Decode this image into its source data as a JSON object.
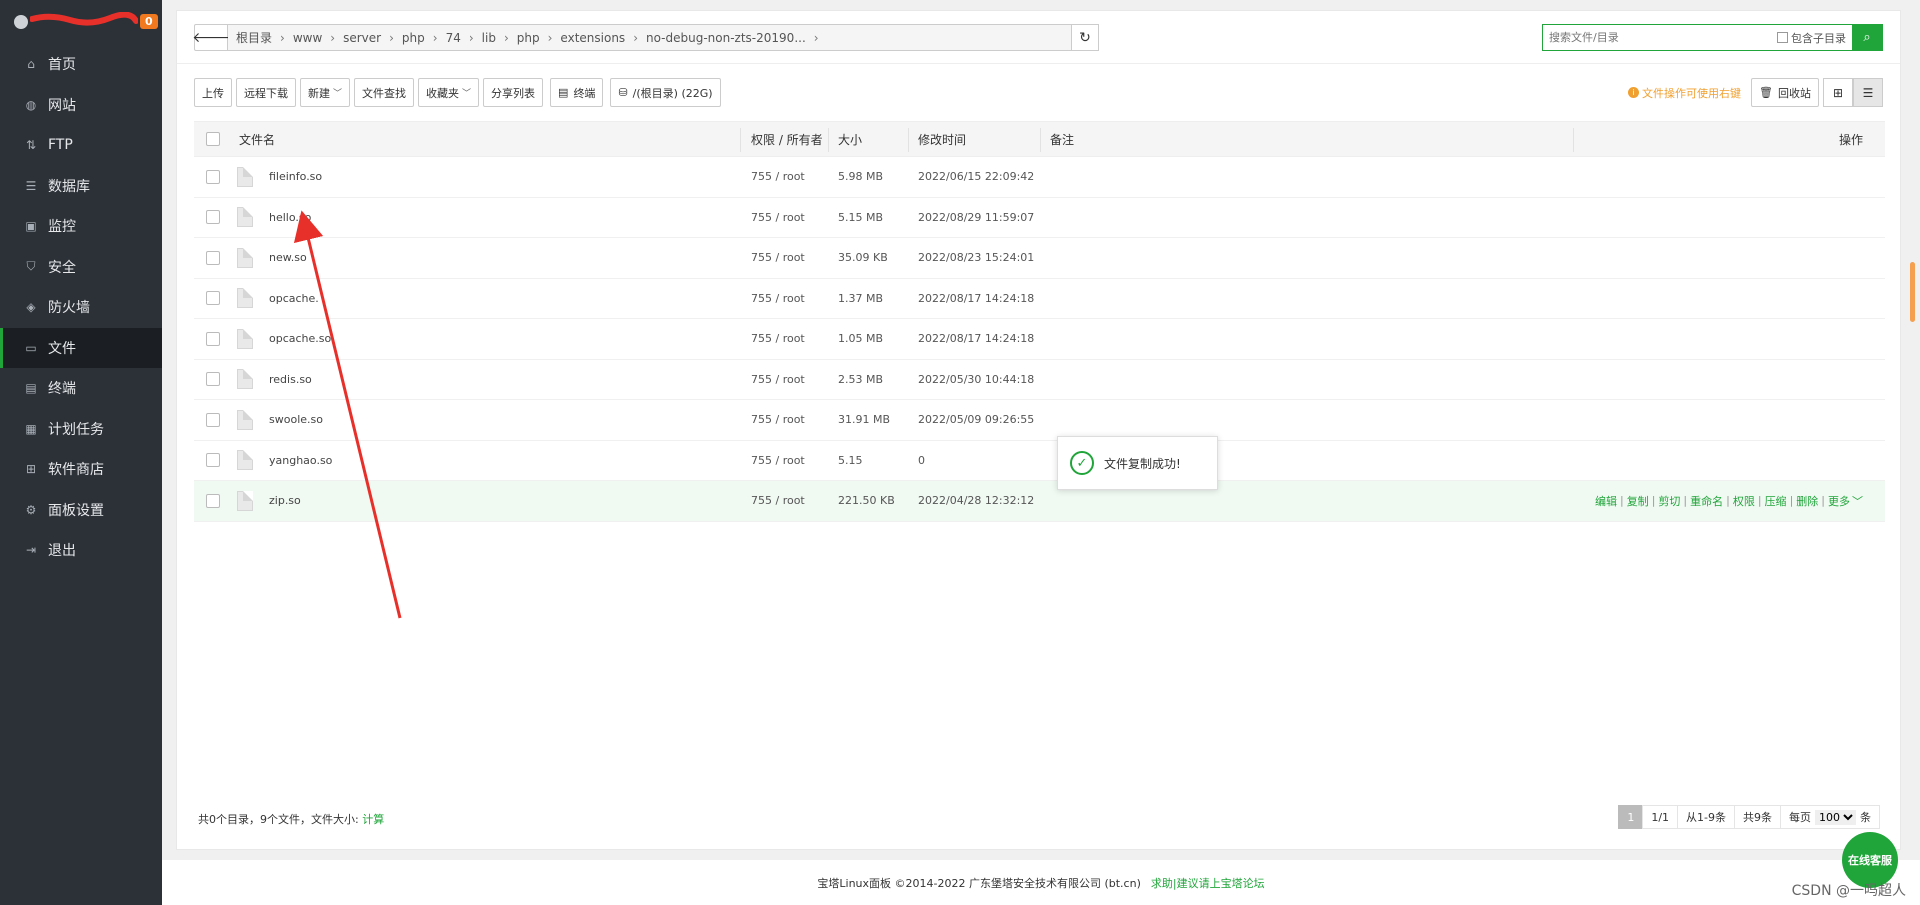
{
  "sidebar": {
    "badge": "0",
    "items": [
      {
        "label": "首页",
        "icon": "home-icon",
        "glyph": "⌂"
      },
      {
        "label": "网站",
        "icon": "globe-icon",
        "glyph": "◍"
      },
      {
        "label": "FTP",
        "icon": "ftp-icon",
        "glyph": "⇅"
      },
      {
        "label": "数据库",
        "icon": "database-icon",
        "glyph": "☰"
      },
      {
        "label": "监控",
        "icon": "monitor-icon",
        "glyph": "▣"
      },
      {
        "label": "安全",
        "icon": "shield-icon",
        "glyph": "⛉"
      },
      {
        "label": "防火墙",
        "icon": "firewall-icon",
        "glyph": "◈"
      },
      {
        "label": "文件",
        "icon": "folder-icon",
        "glyph": "▭",
        "active": true
      },
      {
        "label": "终端",
        "icon": "terminal-icon",
        "glyph": "▤"
      },
      {
        "label": "计划任务",
        "icon": "calendar-icon",
        "glyph": "▦"
      },
      {
        "label": "软件商店",
        "icon": "apps-icon",
        "glyph": "⊞"
      },
      {
        "label": "面板设置",
        "icon": "gear-icon",
        "glyph": "⚙"
      },
      {
        "label": "退出",
        "icon": "logout-icon",
        "glyph": "⇥"
      }
    ]
  },
  "breadcrumb": [
    "根目录",
    "www",
    "server",
    "php",
    "74",
    "lib",
    "php",
    "extensions",
    "no-debug-non-zts-20190..."
  ],
  "search": {
    "placeholder": "搜索文件/目录",
    "include_sub": "包含子目录"
  },
  "toolbar": {
    "upload": "上传",
    "remote_download": "远程下载",
    "new": "新建",
    "file_search": "文件查找",
    "favorites": "收藏夹",
    "share_list": "分享列表",
    "terminal": "终端",
    "disk": "/(根目录) (22G)",
    "hint": "文件操作可使用右键",
    "recycle": "回收站"
  },
  "table": {
    "headers": {
      "name": "文件名",
      "perm": "权限 / 所有者",
      "size": "大小",
      "mtime": "修改时间",
      "note": "备注",
      "ops": "操作"
    },
    "rows": [
      {
        "name": "fileinfo.so",
        "perm": "755 / root",
        "size": "5.98 MB",
        "mtime": "2022/06/15 22:09:42"
      },
      {
        "name": "hello.so",
        "perm": "755 / root",
        "size": "5.15 MB",
        "mtime": "2022/08/29 11:59:07"
      },
      {
        "name": "new.so",
        "perm": "755 / root",
        "size": "35.09 KB",
        "mtime": "2022/08/23 15:24:01"
      },
      {
        "name": "opcache.",
        "perm": "755 / root",
        "size": "1.37 MB",
        "mtime": "2022/08/17 14:24:18"
      },
      {
        "name": "opcache.so",
        "perm": "755 / root",
        "size": "1.05 MB",
        "mtime": "2022/08/17 14:24:18"
      },
      {
        "name": "redis.so",
        "perm": "755 / root",
        "size": "2.53 MB",
        "mtime": "2022/05/30 10:44:18"
      },
      {
        "name": "swoole.so",
        "perm": "755 / root",
        "size": "31.91 MB",
        "mtime": "2022/05/09 09:26:55"
      },
      {
        "name": "yanghao.so",
        "perm": "755 / root",
        "size": "5.15",
        "mtime": "0"
      },
      {
        "name": "zip.so",
        "perm": "755 / root",
        "size": "221.50 KB",
        "mtime": "2022/04/28 12:32:12",
        "highlight": true
      }
    ],
    "row_ops": [
      "编辑",
      "复制",
      "剪切",
      "重命名",
      "权限",
      "压缩",
      "删除",
      "更多"
    ]
  },
  "toast": "文件复制成功!",
  "summary": {
    "text": "共0个目录，9个文件，文件大小:",
    "calc": "计算"
  },
  "pager": {
    "current": "1",
    "pages": "1/1",
    "range": "从1-9条",
    "total": "共9条",
    "per_page_label": "每页",
    "per_page": "100",
    "unit": "条"
  },
  "footer": {
    "copyright": "宝塔Linux面板 ©2014-2022 广东堡塔安全技术有限公司 (bt.cn)",
    "forum": "求助|建议请上宝塔论坛"
  },
  "chat": "在线客服",
  "watermark": "CSDN @一吗超人",
  "colors": {
    "accent": "#20a53a",
    "sidebar": "#2c3138",
    "hint": "#f0a030",
    "annotation": "#e8302a"
  }
}
